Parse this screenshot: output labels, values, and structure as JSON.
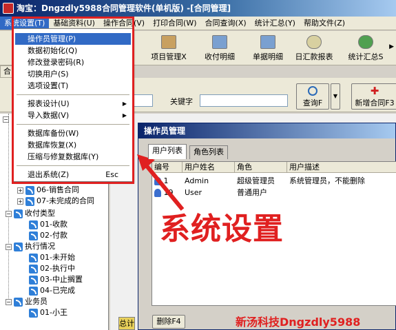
{
  "window": {
    "title": "淘宝：Dngzdly5988合同管理软件(单机版)      -[合同管理]"
  },
  "menubar": {
    "items": [
      "系统设置(T)",
      "基础资料(U)",
      "操作合同(V)",
      "打印合同(W)",
      "合同查询(X)",
      "统计汇总(Y)",
      "帮助文件(Z)"
    ]
  },
  "toolbar": {
    "buttons": [
      "项目管理X",
      "收付明细",
      "单据明细",
      "日汇款报表",
      "统计汇总S"
    ]
  },
  "left_tab": "合",
  "search": {
    "keyword_label": "关键字",
    "keyword_value": "",
    "query_button": "查询F",
    "new_contract_button": "新增合同F3"
  },
  "tree": {
    "nodes": [
      {
        "text": "06-销售合同",
        "level": 2
      },
      {
        "text": "07-未完成的合同",
        "level": 2
      },
      {
        "text": "收付类型",
        "level": 1
      },
      {
        "text": "01-收款",
        "level": 2
      },
      {
        "text": "02-付款",
        "level": 2
      },
      {
        "text": "执行情况",
        "level": 1
      },
      {
        "text": "01-未开始",
        "level": 2
      },
      {
        "text": "02-执行中",
        "level": 2
      },
      {
        "text": "03-中止搁置",
        "level": 2
      },
      {
        "text": "04-已完成",
        "level": 2
      },
      {
        "text": "业务员",
        "level": 1
      },
      {
        "text": "01-小王",
        "level": 2
      }
    ]
  },
  "status_cell": "总计",
  "dialog": {
    "title": "操作员管理",
    "tabs": [
      "用户列表",
      "角色列表"
    ],
    "columns": [
      "编号",
      "用户姓名",
      "角色",
      "用户描述"
    ],
    "rows": [
      {
        "id": "1",
        "name": "Admin",
        "role": "超级管理员",
        "desc": "系统管理员，不能删除"
      },
      {
        "id": "19",
        "name": "User",
        "role": "普通用户",
        "desc": ""
      }
    ],
    "delete_button": "删除F4"
  },
  "dropdown": {
    "items": [
      {
        "label": "操作员管理(P)",
        "highlight": true
      },
      {
        "label": "数据初始化(Q)"
      },
      {
        "label": "修改登录密码(R)"
      },
      {
        "label": "切换用户(S)"
      },
      {
        "label": "选项设置(T)"
      },
      {
        "label": "报表设计(U)",
        "submenu": true
      },
      {
        "label": "导入数据(V)",
        "submenu": true
      },
      {
        "label": "数据库备份(W)"
      },
      {
        "label": "数据库恢复(X)"
      },
      {
        "label": "压缩与修复数据库(Y)"
      },
      {
        "label": "退出系统(Z)",
        "shortcut": "Esc"
      }
    ]
  },
  "annotation": "系统设置",
  "watermark": "新汤科技Dngzdly5988",
  "colors": {
    "highlight": "#316ac5",
    "annotation_red": "#e02020",
    "title_blue": "#0a246a"
  }
}
